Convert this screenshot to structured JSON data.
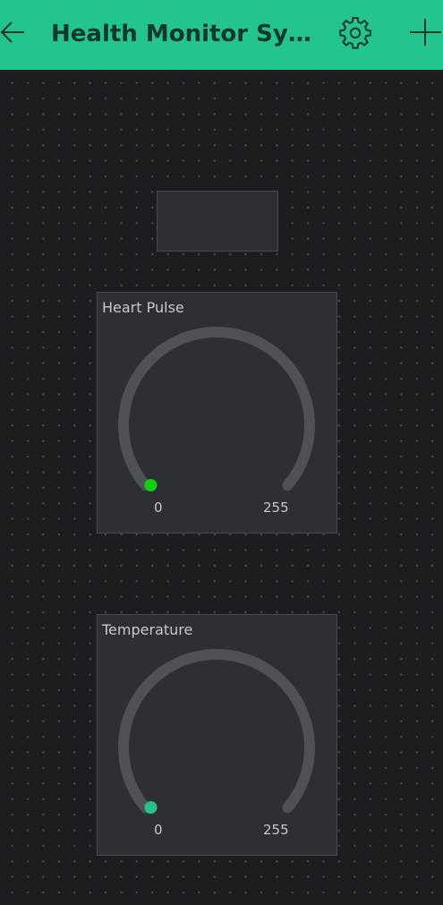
{
  "appbar": {
    "title": "Health Monitor System",
    "accent_color": "#23c48e",
    "back_icon": "arrow-left-icon",
    "settings_icon": "gear-icon",
    "add_icon": "plus-icon"
  },
  "widgets": {
    "value_display": {
      "value": ""
    },
    "heart_pulse": {
      "label": "Heart Pulse",
      "min": "0",
      "max": "255",
      "value": 0,
      "indicator_color": "#10d010"
    },
    "temperature": {
      "label": "Temperature",
      "min": "0",
      "max": "255",
      "value": 0,
      "indicator_color": "#23c48e"
    }
  }
}
